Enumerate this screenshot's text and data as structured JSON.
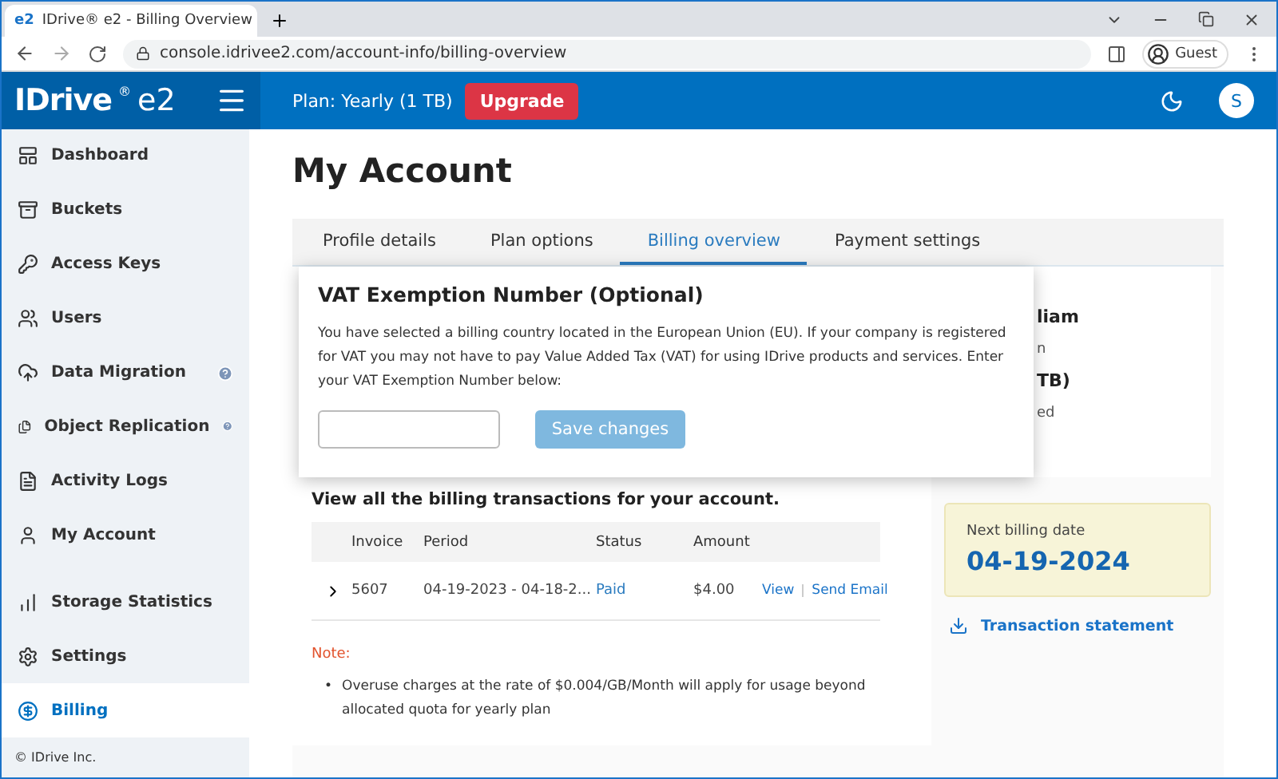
{
  "browser": {
    "favicon": "e2",
    "tab_title": "IDrive® e2 - Billing Overview",
    "url": "console.idrivee2.com/account-info/billing-overview",
    "profile": "Guest"
  },
  "header": {
    "logo": "IDrive",
    "logo_mark": "®",
    "logo_suffix": "e2",
    "plan": "Plan: Yearly (1 TB)",
    "upgrade": "Upgrade",
    "avatar": "S"
  },
  "sidebar": {
    "items": [
      {
        "label": "Dashboard",
        "help": false,
        "selected": false
      },
      {
        "label": "Buckets",
        "help": false,
        "selected": false
      },
      {
        "label": "Access Keys",
        "help": false,
        "selected": false
      },
      {
        "label": "Users",
        "help": false,
        "selected": false
      },
      {
        "label": "Data Migration",
        "help": true,
        "selected": false
      },
      {
        "label": "Object Replication",
        "help": true,
        "selected": false
      },
      {
        "label": "Activity Logs",
        "help": false,
        "selected": false
      },
      {
        "label": "My Account",
        "help": false,
        "selected": false
      },
      {
        "label": "Storage Statistics",
        "help": false,
        "selected": false
      },
      {
        "label": "Settings",
        "help": false,
        "selected": false
      },
      {
        "label": "Billing",
        "help": false,
        "selected": true
      }
    ],
    "footer": "© IDrive Inc."
  },
  "page_title": "My Account",
  "tabs": [
    {
      "label": "Profile details",
      "selected": false
    },
    {
      "label": "Plan options",
      "selected": false
    },
    {
      "label": "Billing overview",
      "selected": true
    },
    {
      "label": "Payment settings",
      "selected": false
    }
  ],
  "vat_popover": {
    "title": "VAT Exemption Number (Optional)",
    "text": "You have selected a billing country located in the European Union (EU). If your company is registered for VAT you may not have to pay Value Added Tax (VAT) for using IDrive products and services. Enter your VAT Exemption Number below:",
    "button": {
      "label": "Save changes",
      "disabled": true
    }
  },
  "transactions": {
    "heading": "View all the billing transactions for your account.",
    "columns": [
      "Invoice",
      "Period",
      "Status",
      "Amount"
    ],
    "rows": [
      {
        "expanded": false,
        "invoice": "5607",
        "period": "04-19-2023 - 04-18-2...",
        "status": "Paid",
        "amount": "$4.00",
        "actions": [
          "View",
          "Send Email"
        ]
      }
    ]
  },
  "note": {
    "label": "Note:",
    "bullet": "•",
    "items": [
      "Overuse charges at the rate of $0.004/GB/Month will apply for usage beyond allocated quota for yearly plan"
    ]
  },
  "summary_fragments": [
    {
      "kind": "value",
      "text": "liam"
    },
    {
      "kind": "label",
      "text": "n"
    },
    {
      "kind": "value",
      "text": "TB)"
    },
    {
      "kind": "label",
      "text": "ed"
    }
  ],
  "next_billing": {
    "label": "Next billing date",
    "date": "04-19-2024"
  },
  "transaction_statement": "Transaction statement"
}
